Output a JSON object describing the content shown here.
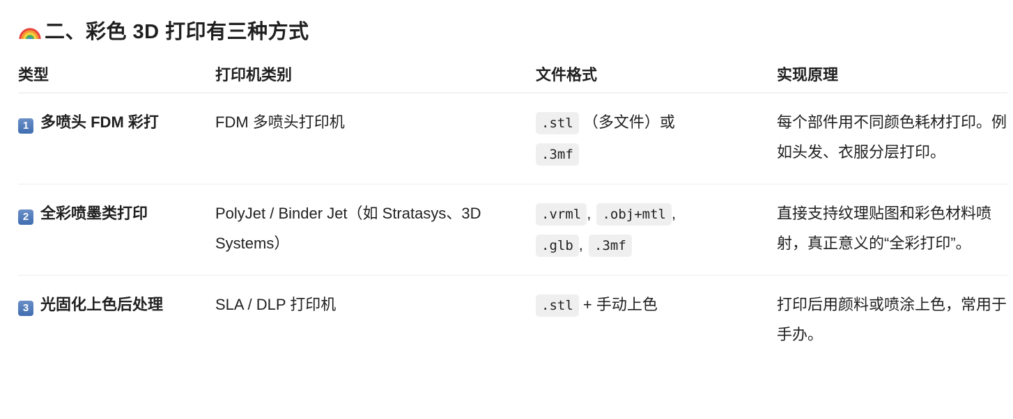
{
  "heading": {
    "icon": "rainbow-icon",
    "text": "二、彩色 3D 打印有三种方式"
  },
  "table": {
    "headers": [
      "类型",
      "打印机类别",
      "文件格式",
      "实现原理"
    ],
    "rows": [
      {
        "num": "1",
        "type": "多喷头 FDM 彩打",
        "printer": "FDM 多喷头打印机",
        "formats": [
          ".stl",
          ".3mf"
        ],
        "format_text_mid": "（多文件）或",
        "principle": "每个部件用不同颜色耗材打印。例如头发、衣服分层打印。"
      },
      {
        "num": "2",
        "type": "全彩喷墨类打印",
        "printer": "PolyJet / Binder Jet（如 Stratasys、3D Systems）",
        "formats": [
          ".vrml",
          ".obj+mtl",
          ".glb",
          ".3mf"
        ],
        "format_sep": ",",
        "principle": "直接支持纹理贴图和彩色材料喷射，真正意义的“全彩打印”。"
      },
      {
        "num": "3",
        "type": "光固化上色后处理",
        "printer": "SLA / DLP 打印机",
        "formats": [
          ".stl"
        ],
        "format_text_after": "+ 手动上色",
        "principle": "打印后用颜料或喷涂上色，常用于手办。"
      }
    ]
  },
  "colors": {
    "text": "#1f1f1f",
    "code_bg": "#efefef",
    "divider": "#eeeeee",
    "badge": "#4f7dbb"
  }
}
